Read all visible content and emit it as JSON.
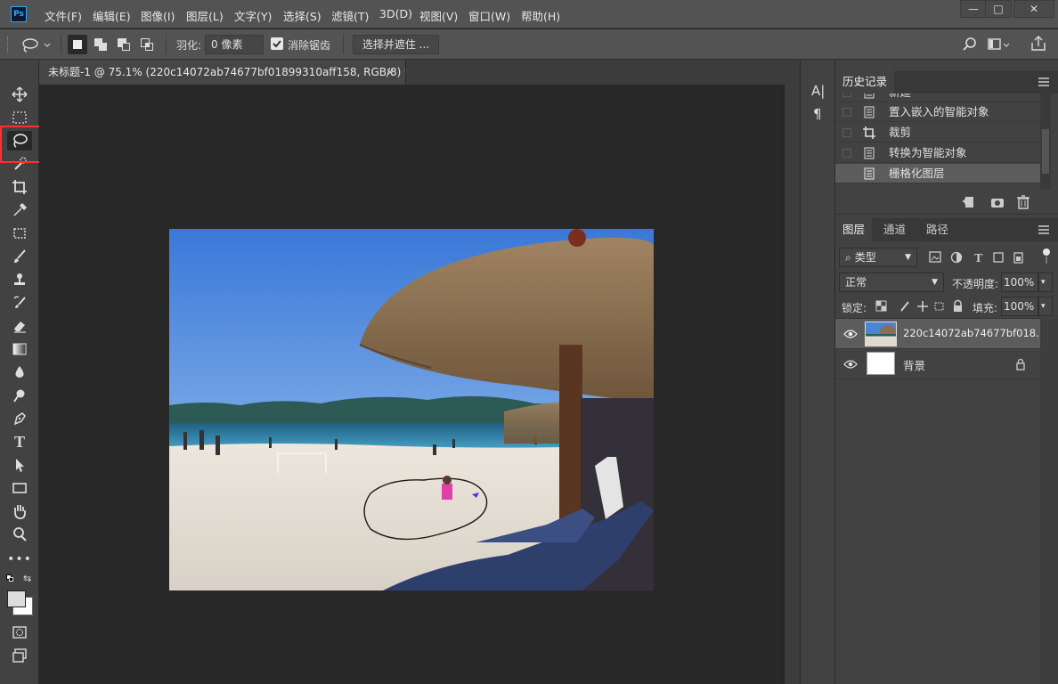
{
  "app": {
    "logo": "Ps"
  },
  "menu": [
    "文件(F)",
    "编辑(E)",
    "图像(I)",
    "图层(L)",
    "文字(Y)",
    "选择(S)",
    "滤镜(T)",
    "3D(D)",
    "视图(V)",
    "窗口(W)",
    "帮助(H)"
  ],
  "window_controls": {
    "minimize": "—",
    "maximize": "□",
    "close": "✕"
  },
  "options": {
    "feather_label": "羽化:",
    "feather_value": "0 像素",
    "antialias_label": "消除锯齿",
    "select_mask_label": "选择并遮住 ..."
  },
  "document": {
    "tab_title": "未标题-1 @ 75.1% (220c14072ab74677bf01899310aff158, RGB/8) *",
    "close": "×"
  },
  "tools": [
    "move-icon",
    "rect-marquee-icon",
    "lasso-icon",
    "quick-select-icon",
    "crop-icon",
    "eyedropper-icon",
    "healing-icon",
    "brush-icon",
    "stamp-icon",
    "history-brush-icon",
    "eraser-icon",
    "gradient-icon",
    "blur-icon",
    "dodge-icon",
    "pen-icon",
    "type-icon",
    "path-select-icon",
    "rectangle-icon",
    "hand-icon",
    "zoom-icon",
    "more-icon"
  ],
  "type_icons": {
    "char": "A|",
    "para": "¶"
  },
  "history": {
    "tab": "历史记录",
    "items": [
      "新建",
      "置入嵌入的智能对象",
      "裁剪",
      "转换为智能对象",
      "栅格化图层"
    ],
    "selected_index": 4
  },
  "layers": {
    "tabs": [
      "图层",
      "通道",
      "路径"
    ],
    "filter_label": "类型",
    "blend_mode": "正常",
    "opacity_label": "不透明度:",
    "opacity_value": "100%",
    "lock_label": "锁定:",
    "fill_label": "填充:",
    "fill_value": "100%",
    "items": [
      {
        "name": "220c14072ab74677bf018...",
        "selected": true
      },
      {
        "name": "背景",
        "selected": false,
        "locked": true
      }
    ]
  },
  "colors": {
    "accent": "#31a8ff",
    "highlight": "#ff3030",
    "selected_row": "#5c5c5c"
  }
}
